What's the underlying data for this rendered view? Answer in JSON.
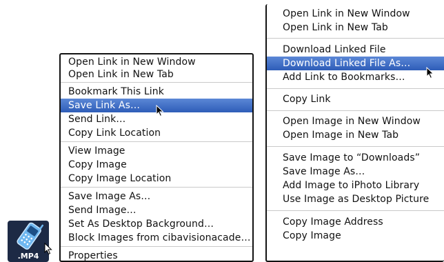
{
  "left_menu": {
    "items": [
      "Open Link in New Window",
      "Open Link in New Tab",
      "Bookmark This Link",
      "Save Link As…",
      "Send Link…",
      "Copy Link Location",
      "View Image",
      "Copy Image",
      "Copy Image Location",
      "Save Image As…",
      "Send Image…",
      "Set As Desktop Background…",
      "Block Images from cibavisionacade…",
      "Properties"
    ],
    "selected": "Save Link As…"
  },
  "right_menu": {
    "items": [
      "Open Link in New Window",
      "Open Link in New Tab",
      "Download Linked File",
      "Download Linked File As…",
      "Add Link to Bookmarks…",
      "Copy Link",
      "Open Image in New Window",
      "Open Image in New Tab",
      "Save Image to “Downloads”",
      "Save Image As…",
      "Add Image to iPhoto Library",
      "Use Image as Desktop Picture",
      "Copy Image Address",
      "Copy Image"
    ],
    "selected": "Download Linked File As…"
  },
  "file_icon": {
    "label": ".MP4",
    "icon": "mobile-phone-icon"
  },
  "colors": {
    "selection": "#3a6bc8",
    "menu_border": "#111111",
    "separator": "#c9c9c9"
  }
}
